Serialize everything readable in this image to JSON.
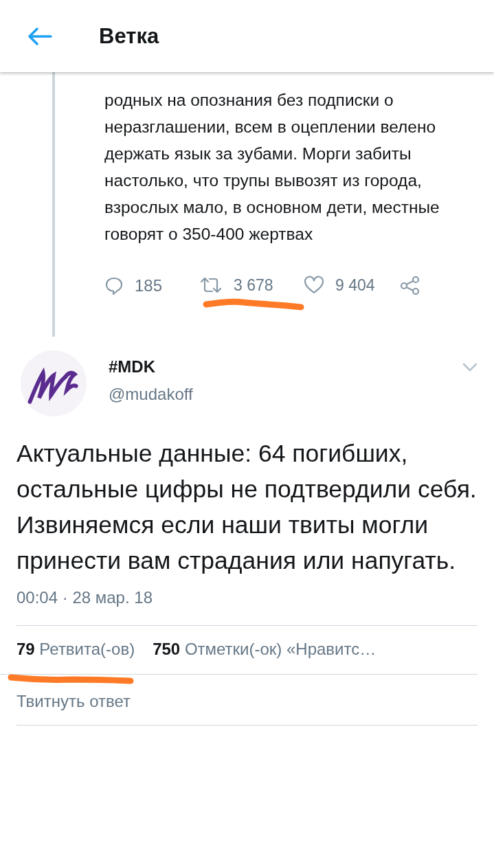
{
  "header": {
    "title": "Ветка"
  },
  "parent_tweet": {
    "text": "родных на опознания без подписки о неразглашении, всем в оцеплении велено держать язык за зубами. Морги забиты настолько, что трупы вывозят из города, взрослых мало, в основном дети, местные говорят о 350-400 жертвах",
    "actions": [
      {
        "kind": "reply",
        "count": "185"
      },
      {
        "kind": "retweet",
        "count": "3 678"
      },
      {
        "kind": "like",
        "count": "9 404"
      },
      {
        "kind": "share"
      }
    ]
  },
  "tweet": {
    "name": "#MDK",
    "handle": "@mudakoff",
    "text": "Актуальные данные: 64 погибших, остальные цифры не подтвердили себя. Извиняемся если наши твиты могли принести вам страдания или напугать.",
    "timestamp": "00:04 · 28 мар. 18",
    "stats": [
      "**79** Ретвита(-ов)",
      "**750** Отметки(-ок) «Нравитс…"
    ]
  },
  "reply": {
    "placeholder": "Твитнуть ответ"
  }
}
